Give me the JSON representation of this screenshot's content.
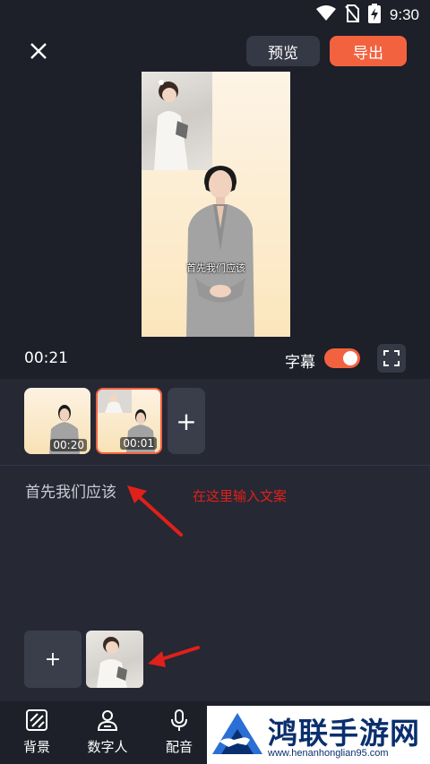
{
  "status_bar": {
    "time": "9:30"
  },
  "top_bar": {
    "preview_label": "预览",
    "export_label": "导出"
  },
  "preview": {
    "subtitle_overlay": "首先我们应该"
  },
  "controls": {
    "current_time": "00:21",
    "subtitle_label": "字幕",
    "subtitle_enabled": true
  },
  "clips": [
    {
      "duration": "00:20",
      "selected": false
    },
    {
      "duration": "00:01",
      "selected": true
    }
  ],
  "add_clip_label": "+",
  "script": {
    "text": "首先我们应该",
    "annotation": "在这里输入文案"
  },
  "avatar": {
    "add_label": "+"
  },
  "bottom_nav": {
    "items": [
      {
        "label": "背景",
        "icon": "background-icon"
      },
      {
        "label": "数字人",
        "icon": "digital-human-icon"
      },
      {
        "label": "配音",
        "icon": "microphone-icon"
      }
    ]
  },
  "watermark": {
    "title": "鸿联手游网",
    "url": "www.henanhonglian95.com"
  },
  "colors": {
    "accent": "#f3623f",
    "background": "#1d1f29",
    "panel": "#262834",
    "annotation": "#e0201a"
  }
}
